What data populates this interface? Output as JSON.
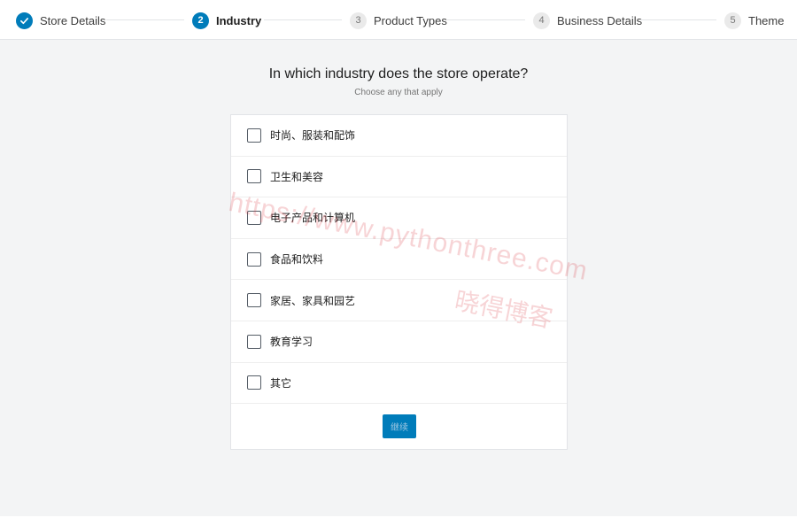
{
  "stepper": {
    "steps": [
      {
        "number": "",
        "label": "Store Details",
        "state": "done"
      },
      {
        "number": "2",
        "label": "Industry",
        "state": "active"
      },
      {
        "number": "3",
        "label": "Product Types",
        "state": "pending"
      },
      {
        "number": "4",
        "label": "Business Details",
        "state": "pending"
      },
      {
        "number": "5",
        "label": "Theme",
        "state": "pending"
      }
    ]
  },
  "main": {
    "heading": "In which industry does the store operate?",
    "subheading": "Choose any that apply",
    "options": [
      {
        "label": "时尚、服装和配饰",
        "checked": false
      },
      {
        "label": "卫生和美容",
        "checked": false
      },
      {
        "label": "电子产品和计算机",
        "checked": false
      },
      {
        "label": "食品和饮料",
        "checked": false
      },
      {
        "label": "家居、家具和园艺",
        "checked": false
      },
      {
        "label": "教育学习",
        "checked": false
      },
      {
        "label": "其它",
        "checked": false
      }
    ],
    "continue_label": "继续"
  },
  "watermark": {
    "url": "https://www.pythonthree.com",
    "name": "晓得博客"
  },
  "colors": {
    "accent": "#007cba",
    "background": "#f3f4f5",
    "card": "#ffffff"
  },
  "icons": {
    "done_step": "checkmark-icon"
  }
}
